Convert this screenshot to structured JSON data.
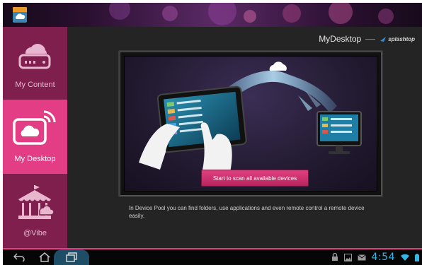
{
  "header": {
    "app_icon": "mydesktop-app-icon",
    "brand_title": "MyDesktop",
    "brand_logo_text": "splashtop"
  },
  "sidebar": {
    "items": [
      {
        "label": "My Content",
        "icon": "cloud-drive-icon",
        "active": false
      },
      {
        "label": "My Desktop",
        "icon": "cloud-screen-icon",
        "active": true
      },
      {
        "label": "@Vibe",
        "icon": "carousel-icon",
        "active": false
      }
    ]
  },
  "main": {
    "scan_button_label": "Start to scan all available devices",
    "description": "In Device Pool you can find folders, use applications and even remote control a remote device easily."
  },
  "navbar": {
    "back": "back-icon",
    "home": "home-icon",
    "recents": "recent-apps-icon"
  },
  "status": {
    "time": "4:54",
    "icons": [
      "lock-icon",
      "image-icon",
      "mail-icon",
      "wifi-icon",
      "battery-icon"
    ]
  },
  "colors": {
    "accent": "#e33d86",
    "sidebar": "#7e1f4e",
    "clock": "#33b5e5"
  }
}
